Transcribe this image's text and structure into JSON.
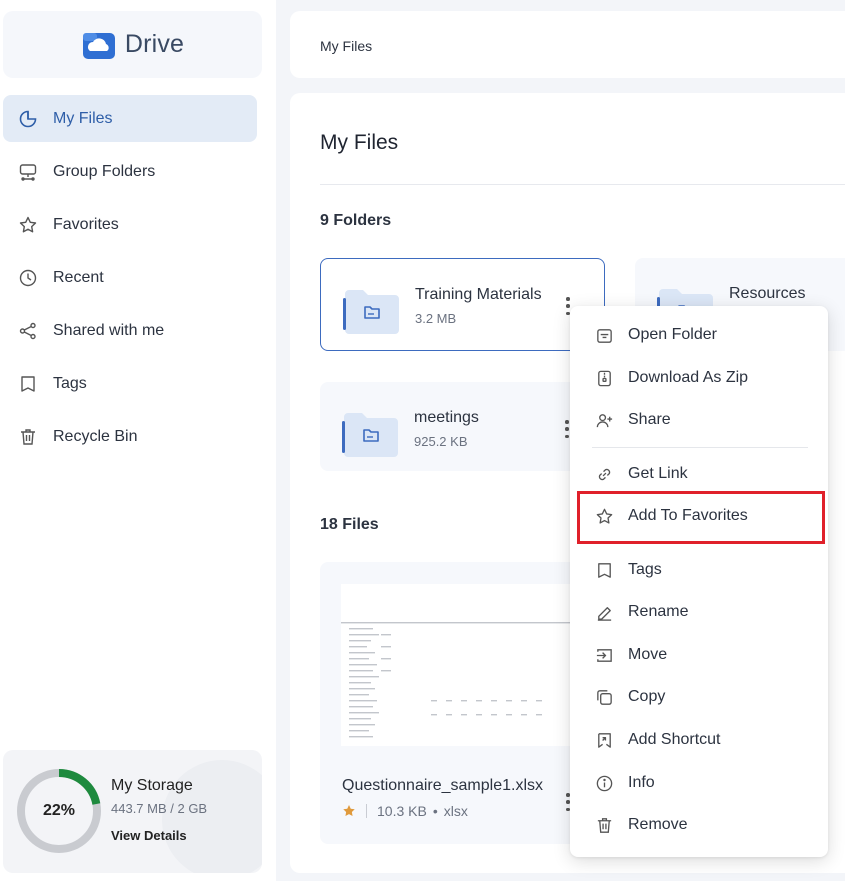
{
  "app": {
    "logo_text": "Drive"
  },
  "sidebar": {
    "items": [
      {
        "label": "My Files",
        "icon": "my-files-icon",
        "active": true
      },
      {
        "label": "Group Folders",
        "icon": "group-folders-icon"
      },
      {
        "label": "Favorites",
        "icon": "star-icon"
      },
      {
        "label": "Recent",
        "icon": "clock-icon"
      },
      {
        "label": "Shared with me",
        "icon": "share-icon"
      },
      {
        "label": "Tags",
        "icon": "tag-icon"
      },
      {
        "label": "Recycle Bin",
        "icon": "trash-icon"
      }
    ],
    "storage": {
      "title": "My Storage",
      "percent_label": "22%",
      "percent": 22,
      "used": "443.7 MB",
      "total": "2 GB",
      "usage_text": "443.7 MB / 2 GB",
      "details_label": "View Details"
    }
  },
  "breadcrumb": {
    "current": "My Files"
  },
  "main": {
    "title": "My Files",
    "folders_heading": "9 Folders",
    "files_heading": "18 Files",
    "folders": [
      {
        "name": "Training Materials",
        "size": "3.2 MB"
      },
      {
        "name": "Resources",
        "size": ""
      },
      {
        "name": "meetings",
        "size": "925.2 KB"
      }
    ],
    "files": [
      {
        "name": "Questionnaire_sample1.xlsx",
        "size": "10.3 KB",
        "ext": "xlsx"
      }
    ]
  },
  "context_menu": {
    "items": [
      {
        "label": "Open Folder",
        "icon": "open-folder-icon"
      },
      {
        "label": "Download As Zip",
        "icon": "zip-icon"
      },
      {
        "label": "Share",
        "icon": "add-user-icon"
      },
      {
        "label": "Get Link",
        "icon": "link-icon"
      },
      {
        "label": "Add To Favorites",
        "icon": "star-icon",
        "highlighted": true
      },
      {
        "label": "Tags",
        "icon": "tag-icon"
      },
      {
        "label": "Rename",
        "icon": "pencil-icon"
      },
      {
        "label": "Move",
        "icon": "move-icon"
      },
      {
        "label": "Copy",
        "icon": "copy-icon"
      },
      {
        "label": "Add Shortcut",
        "icon": "shortcut-icon"
      },
      {
        "label": "Info",
        "icon": "info-icon"
      },
      {
        "label": "Remove",
        "icon": "trash-icon"
      }
    ]
  },
  "colors": {
    "accent": "#2e5ea8",
    "active_bg": "#e3ebf6",
    "highlight_box": "#e0202a",
    "storage_ring": "#1e8a3e"
  }
}
